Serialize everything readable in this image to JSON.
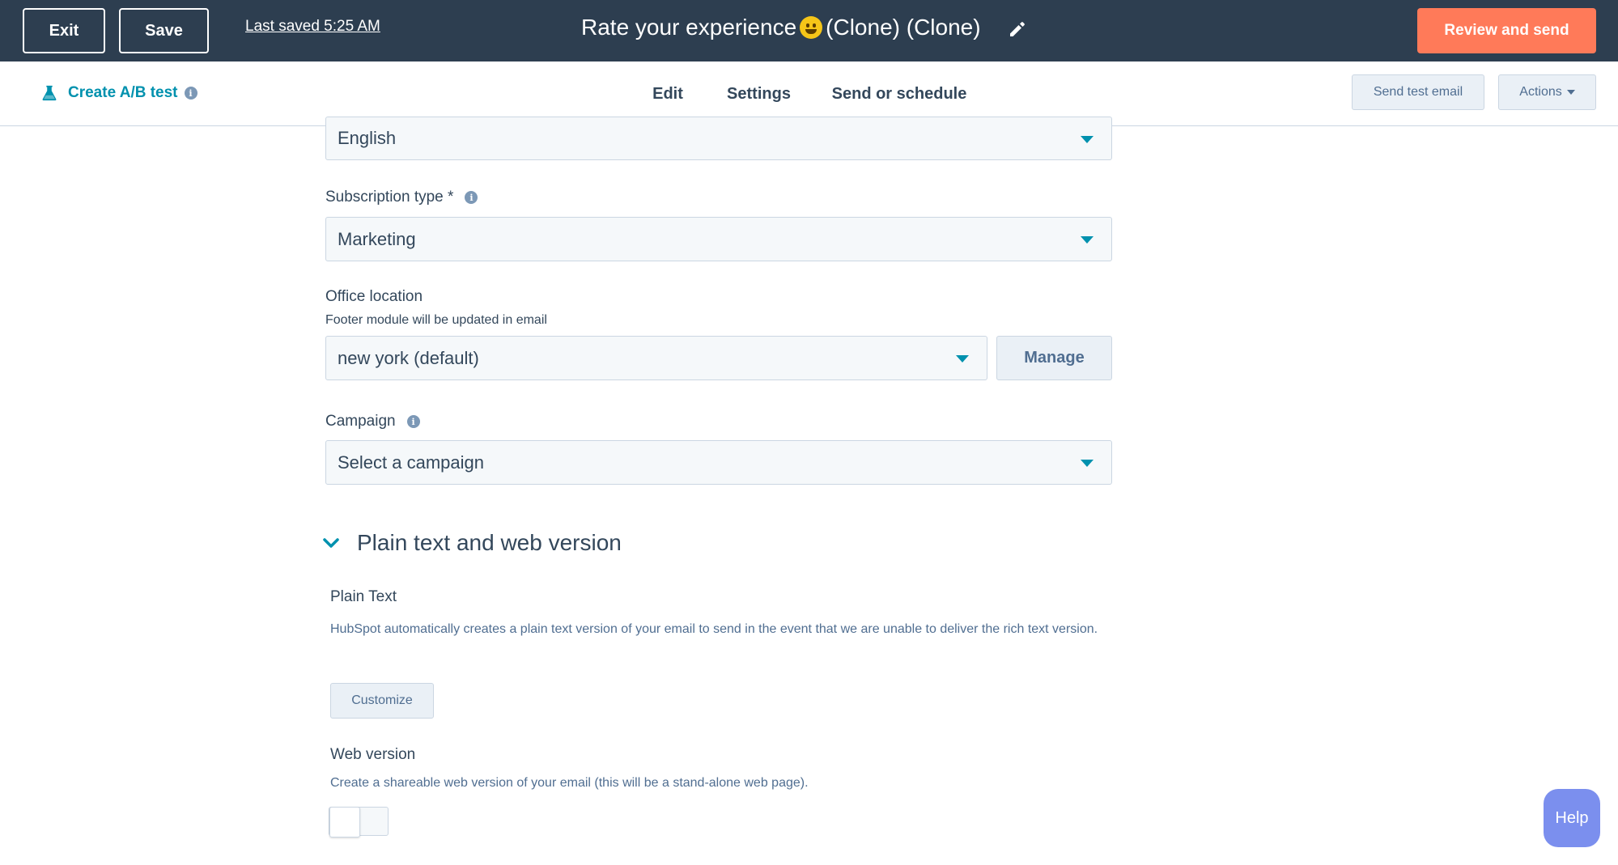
{
  "topbar": {
    "exit_label": "Exit",
    "save_label": "Save",
    "last_saved": "Last saved 5:25 AM",
    "title_before": "Rate your experience",
    "title_after": "(Clone) (Clone)",
    "review_label": "Review and send"
  },
  "subbar": {
    "ab_test_label": "Create A/B test",
    "tabs": [
      {
        "label": "Edit"
      },
      {
        "label": "Settings",
        "active": true
      },
      {
        "label": "Send or schedule"
      }
    ],
    "send_test_label": "Send test email",
    "actions_label": "Actions"
  },
  "form": {
    "language_value": "English",
    "subscription_label": "Subscription type *",
    "subscription_value": "Marketing",
    "office_label": "Office location",
    "office_help": "Footer module will be updated in email",
    "office_value": "new york (default)",
    "manage_label": "Manage",
    "campaign_label": "Campaign",
    "campaign_placeholder": "Select a campaign"
  },
  "plain_section": {
    "title": "Plain text and web version",
    "plain_text_title": "Plain Text",
    "plain_text_desc": "HubSpot automatically creates a plain text version of your email to send in the event that we are unable to deliver the rich text version.",
    "customize_label": "Customize",
    "web_version_title": "Web version",
    "web_version_desc": "Create a shareable web version of your email (this will be a stand-alone web page).",
    "web_version_enabled": false
  },
  "help_label": "Help",
  "colors": {
    "topbar": "#2d3e50",
    "primary": "#ff7a59",
    "link": "#0091ae",
    "help": "#7b8fee"
  },
  "icons": [
    "flask-icon",
    "info-icon",
    "pencil-icon",
    "chevron-down-icon",
    "caret-down-icon",
    "emoji-icon"
  ]
}
